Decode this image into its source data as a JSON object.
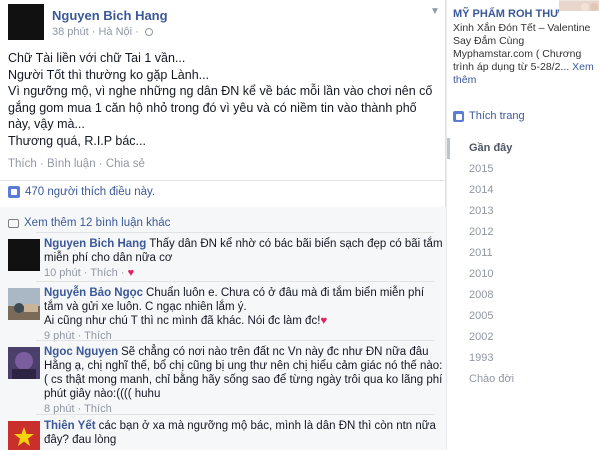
{
  "post": {
    "author": "Nguyen Bich Hang",
    "time": "38 phút",
    "location": "Hà Nội",
    "body": [
      "Chữ Tài liền với chữ Tai 1 vần...",
      "Người Tốt thì thường ko gặp Lành...",
      "Vì ngưỡng mộ, vì nghe những ng dân ĐN kể về bác mỗi lần vào chơi nên cố gắng gom mua 1 căn hộ nhỏ trong đó vì yêu và có niềm tin vào thành phố này, vậy mà...",
      "Thương quá, R.I.P bác..."
    ],
    "actions": [
      "Thích",
      "Bình luận",
      "Chia sẻ"
    ],
    "likes": "470 người thích điều này.",
    "more_comments": "Xem thêm 12 bình luận khác"
  },
  "comments": [
    {
      "author": "Nguyen Bich Hang",
      "text": "Thấy dân ĐN kể nhờ có bác bãi biển sạch đẹp có bãi tắm miễn phí cho dân nữa cơ",
      "emoji": "♥",
      "time": "10 phút",
      "action": "Thích",
      "avatar_color": "#111111"
    },
    {
      "author": "Nguyễn Bảo Ngọc",
      "text": "Chuẩn luôn e. Chưa có ở đâu mà đi tắm biển miễn phí tắm và gửi xe luôn. C ngạc nhiên lắm ý.",
      "text2": "Ai cũng như chú T thì nc mình đã khác. Nói đc làm đc!",
      "emoji": "♥",
      "time": "9 phút",
      "action": "Thích",
      "avatar_color": "#8b7a6a"
    },
    {
      "author": "Ngoc Nguyen",
      "text": "Sẽ chẳng có nơi nào trên đất nc Vn này đc như ĐN nữa đâu Hằng ạ, chị nghĩ thế, bổ chị cũng bị ung thư nên chị hiểu cảm giác nó thế nào:( cs thật mong manh, chỉ bằng hãy sống sao để từng ngày trôi qua ko lãng phí phút giây nào:(((( huhu",
      "time": "8 phút",
      "action": "Thích",
      "avatar_color": "#5a4a7a"
    },
    {
      "author": "Thiên Yết",
      "text": "các bạn ở xa mà ngưỡng mộ bác, mình là dân ĐN thì còn ntn nữa đây? đau lòng",
      "avatar_color": "#c0392b"
    }
  ],
  "sidebar": {
    "ad_title": "MỸ PHẨM ROH THƯ",
    "ad_text": "Xinh Xắn Đón Tết – Valentine Say Đắm Cùng Myphamstar.com ( Chương trình áp dụng từ 5-28/2...",
    "ad_more": "Xem thêm",
    "ad_like": "Thích trang",
    "timeline": [
      "Gần đây",
      "2015",
      "2014",
      "2013",
      "2012",
      "2011",
      "2010",
      "2008",
      "2005",
      "2002",
      "1993",
      "Chào đời"
    ]
  },
  "colors": {
    "link": "#3b5998",
    "meta": "#9197a3",
    "heart": "#e0245e"
  }
}
